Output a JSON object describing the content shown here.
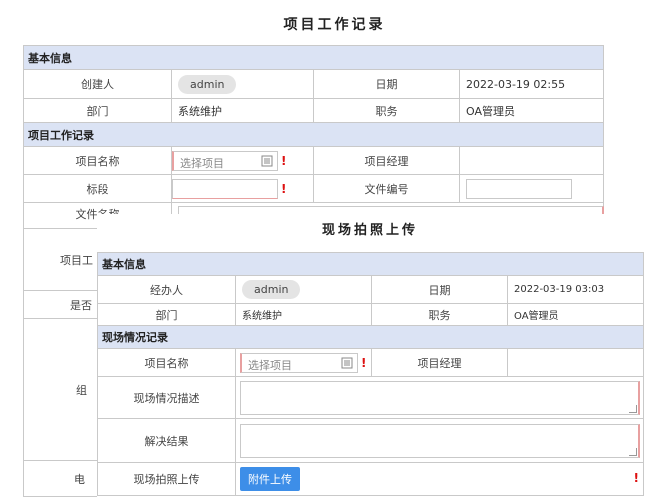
{
  "back": {
    "title": "项目工作记录",
    "section_basic": "基本信息",
    "creator_label": "创建人",
    "creator_value": "admin",
    "date_label": "日期",
    "date_value": "2022-03-19 02:55",
    "dept_label": "部门",
    "dept_value": "系统维护",
    "position_label": "职务",
    "position_value": "OA管理员",
    "section_work": "项目工作记录",
    "project_name_label": "项目名称",
    "project_placeholder": "选择项目",
    "project_manager_label": "项目经理",
    "tender_label": "标段",
    "file_no_label": "文件编号",
    "file_name_label_partial": "文件名称",
    "row_a_partial": "项目工",
    "row_b_partial": "是否",
    "row_c_partial": "组",
    "row_d_partial": "电"
  },
  "front": {
    "title": "现场拍照上传",
    "section_basic": "基本信息",
    "handler_label": "经办人",
    "handler_value": "admin",
    "date_label": "日期",
    "date_value": "2022-03-19 03:03",
    "dept_label": "部门",
    "dept_value": "系统维护",
    "position_label": "职务",
    "position_value": "OA管理员",
    "section_site": "现场情况记录",
    "project_name_label": "项目名称",
    "project_placeholder": "选择项目",
    "project_manager_label": "项目经理",
    "site_desc_label": "现场情况描述",
    "solution_label": "解决结果",
    "photo_label": "现场拍照上传",
    "upload_button": "附件上传"
  },
  "icons": {
    "select": "calendar-list-icon",
    "required": "required-asterisk"
  },
  "colors": {
    "section_bg": "#dbe3f4",
    "button": "#3d8ee8",
    "required": "#dd1111"
  }
}
